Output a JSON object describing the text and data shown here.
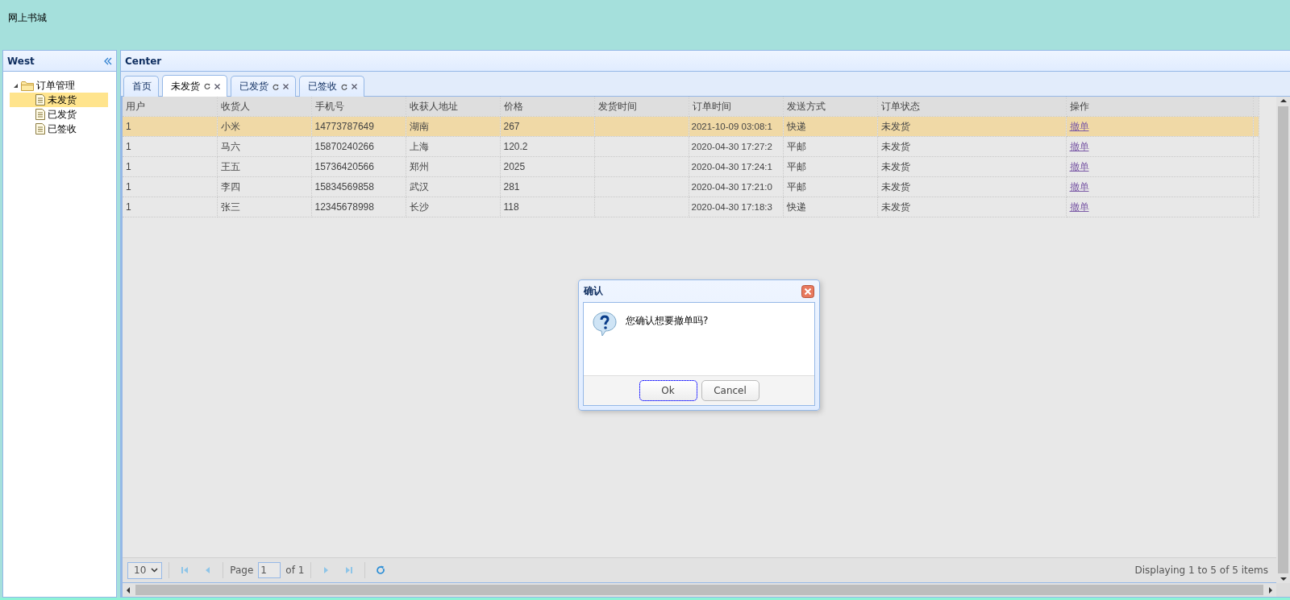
{
  "app": {
    "title": "网上书城"
  },
  "west": {
    "title": "West",
    "tree": [
      {
        "label": "订单管理",
        "expanded": true,
        "children": [
          {
            "label": "未发货",
            "selected": true
          },
          {
            "label": "已发货",
            "selected": false
          },
          {
            "label": "已签收",
            "selected": false
          }
        ]
      }
    ]
  },
  "center": {
    "title": "Center",
    "tabs": [
      {
        "label": "首页",
        "selected": false,
        "closable": false
      },
      {
        "label": "未发货",
        "selected": true,
        "closable": true
      },
      {
        "label": "已发货",
        "selected": false,
        "closable": true
      },
      {
        "label": "已签收",
        "selected": false,
        "closable": true
      }
    ],
    "table": {
      "columns": [
        "用户",
        "收货人",
        "手机号",
        "收获人地址",
        "价格",
        "发货时间",
        "订单时间",
        "发送方式",
        "订单状态",
        "操作"
      ],
      "rows": [
        {
          "selected": true,
          "cells": [
            "1",
            "小米",
            "14773787649",
            "湖南",
            "267",
            null,
            "2021-10-09 03:08:1",
            "快递",
            "未发货",
            "撤单"
          ]
        },
        {
          "selected": false,
          "cells": [
            "1",
            "马六",
            "15870240266",
            "上海",
            "120.2",
            null,
            "2020-04-30 17:27:2",
            "平邮",
            "未发货",
            "撤单"
          ]
        },
        {
          "selected": false,
          "cells": [
            "1",
            "王五",
            "15736420566",
            "郑州",
            "2025",
            null,
            "2020-04-30 17:24:1",
            "平邮",
            "未发货",
            "撤单"
          ]
        },
        {
          "selected": false,
          "cells": [
            "1",
            "李四",
            "15834569858",
            "武汉",
            "281",
            null,
            "2020-04-30 17:21:0",
            "平邮",
            "未发货",
            "撤单"
          ]
        },
        {
          "selected": false,
          "cells": [
            "1",
            "张三",
            "12345678998",
            "长沙",
            "118",
            null,
            "2020-04-30 17:18:3",
            "快递",
            "未发货",
            "撤单"
          ]
        }
      ]
    },
    "pager": {
      "page_size": "10",
      "page_label": "Page",
      "page": "1",
      "of": "of 1",
      "info": "Displaying 1 to 5 of 5 items"
    }
  },
  "dialog": {
    "title": "确认",
    "message": "您确认想要撤单吗?",
    "buttons": [
      {
        "label": "Ok",
        "focused": true
      },
      {
        "label": "Cancel",
        "focused": false
      }
    ]
  }
}
